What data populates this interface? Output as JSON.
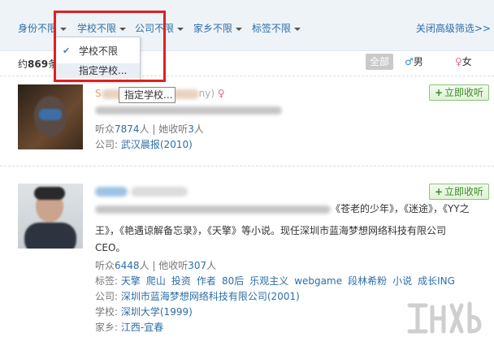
{
  "filters": [
    {
      "label": "身份不限"
    },
    {
      "label": "学校不限"
    },
    {
      "label": "公司不限"
    },
    {
      "label": "家乡不限"
    },
    {
      "label": "标签不限"
    }
  ],
  "close_advanced": "关闭高级筛选>>",
  "result_prefix": "约",
  "result_count": "869",
  "result_suffix": "条",
  "gender": {
    "all": "全部",
    "male_symbol": "♂",
    "male": "男",
    "female_symbol": "♀",
    "female": "女"
  },
  "dropdown": {
    "items": [
      {
        "label": "学校不限",
        "check": "✔"
      },
      {
        "label": "指定学校..."
      }
    ]
  },
  "tooltip": "指定学校...",
  "results": [
    {
      "name_visible": "S",
      "name_suffix": "ny)",
      "gender_symbol": "♀",
      "followers_label": "听众",
      "followers": "7874",
      "followers_unit": "人",
      "following_label": "她收听",
      "following": "3",
      "following_unit": "人",
      "company_label": "公司:",
      "company": "武汉晨报(2010)",
      "follow_button": "立即收听",
      "colors": {
        "accent": "#e06a8d"
      }
    },
    {
      "bio_line1_end": "《苍老的少年》，《迷途》，《YY之",
      "bio_line2": "王》，《艳遇谅解备忘录》，《天擎》等小说。现任深圳市蓝海梦想网络科技有限公司",
      "bio_line3": "CEO。",
      "followers_label": "听众",
      "followers": "6448",
      "followers_unit": "人",
      "following_label": "他收听",
      "following": "307",
      "following_unit": "人",
      "tags_label": "标签:",
      "tags": [
        "天擎",
        "爬山",
        "投资",
        "作者",
        "80后",
        "乐观主义",
        "webgame",
        "段林希粉",
        "小说",
        "成长ING"
      ],
      "company_label": "公司:",
      "company": "深圳市蓝海梦想网络科技有限公司(2001)",
      "school_label": "学校:",
      "school": "深圳大学(1999)",
      "hometown_label": "家乡:",
      "hometown": "江西-宜春",
      "follow_button": "立即收听"
    }
  ]
}
